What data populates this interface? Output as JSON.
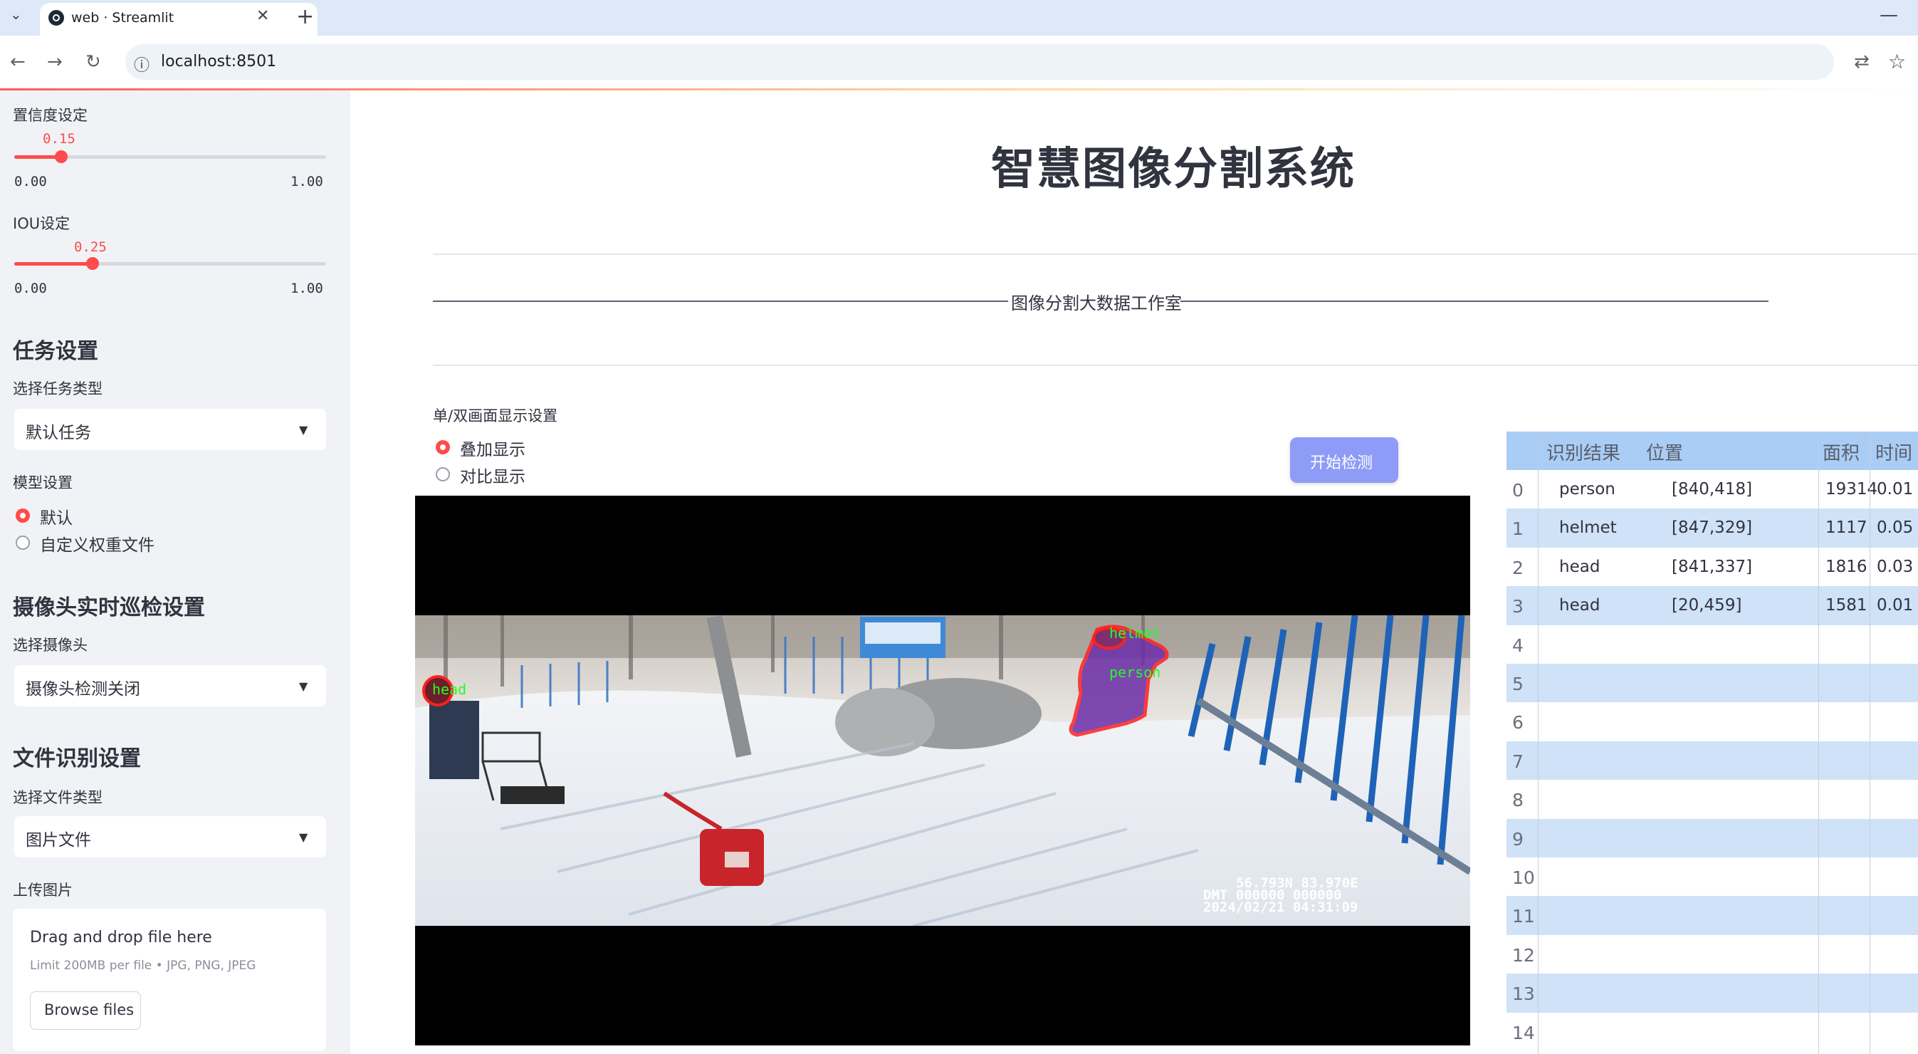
{
  "browser": {
    "tab_title": "web · Streamlit",
    "url": "localhost:8501",
    "icons": {
      "tab_list": "chevron-down-icon",
      "close": "close-icon",
      "new_tab": "plus-icon",
      "back": "arrow-left-icon",
      "forward": "arrow-right-icon",
      "reload": "reload-icon",
      "site_info": "info-icon",
      "translate": "translate-icon",
      "bookmark": "star-icon",
      "minimize": "minimize-icon"
    }
  },
  "sidebar": {
    "confidence": {
      "label": "置信度设定",
      "value": "0.15",
      "min": "0.00",
      "max": "1.00",
      "fraction": 0.15
    },
    "iou": {
      "label": "IOU设定",
      "value": "0.25",
      "min": "0.00",
      "max": "1.00",
      "fraction": 0.25
    },
    "task": {
      "header": "任务设置",
      "label": "选择任务类型",
      "selected": "默认任务"
    },
    "model": {
      "label": "模型设置",
      "options": [
        "默认",
        "自定义权重文件"
      ],
      "selected_index": 0
    },
    "camera": {
      "header": "摄像头实时巡检设置",
      "label": "选择摄像头",
      "selected": "摄像头检测关闭"
    },
    "file": {
      "header": "文件识别设置",
      "label": "选择文件类型",
      "selected": "图片文件"
    },
    "upload": {
      "label": "上传图片",
      "drop_text": "Drag and drop file here",
      "limit_text": "Limit 200MB per file • JPG, PNG, JPEG",
      "browse_label": "Browse files"
    }
  },
  "main": {
    "title": "智慧图像分割系统",
    "divider_text": "图像分割大数据工作室",
    "display_label": "单/双画面显示设置",
    "display_options": [
      "叠加显示",
      "对比显示"
    ],
    "display_selected_index": 0,
    "start_button": "开始检测",
    "image": {
      "labels": {
        "head_left": "head",
        "helmet": "helmet",
        "person": "person"
      },
      "osd": [
        "56.793N  83.970E",
        "DMT 000000 000000",
        "2024/02/21 04:31:09"
      ]
    }
  },
  "results_table": {
    "columns": [
      "识别结果",
      "位置",
      "面积",
      "时间"
    ],
    "rows": [
      {
        "index": "0",
        "label": "person",
        "position": "[840,418]",
        "area": "19314",
        "time": "0.01"
      },
      {
        "index": "1",
        "label": "helmet",
        "position": "[847,329]",
        "area": "1117",
        "time": "0.05"
      },
      {
        "index": "2",
        "label": "head",
        "position": "[841,337]",
        "area": "1816",
        "time": "0.03"
      },
      {
        "index": "3",
        "label": "head",
        "position": "[20,459]",
        "area": "1581",
        "time": "0.01"
      },
      {
        "index": "4",
        "label": "",
        "position": "",
        "area": "",
        "time": ""
      },
      {
        "index": "5",
        "label": "",
        "position": "",
        "area": "",
        "time": ""
      },
      {
        "index": "6",
        "label": "",
        "position": "",
        "area": "",
        "time": ""
      },
      {
        "index": "7",
        "label": "",
        "position": "",
        "area": "",
        "time": ""
      },
      {
        "index": "8",
        "label": "",
        "position": "",
        "area": "",
        "time": ""
      },
      {
        "index": "9",
        "label": "",
        "position": "",
        "area": "",
        "time": ""
      },
      {
        "index": "10",
        "label": "",
        "position": "",
        "area": "",
        "time": ""
      },
      {
        "index": "11",
        "label": "",
        "position": "",
        "area": "",
        "time": ""
      },
      {
        "index": "12",
        "label": "",
        "position": "",
        "area": "",
        "time": ""
      },
      {
        "index": "13",
        "label": "",
        "position": "",
        "area": "",
        "time": ""
      },
      {
        "index": "14",
        "label": "",
        "position": "",
        "area": "",
        "time": ""
      }
    ]
  },
  "colors": {
    "accent": "#ff4b4b",
    "button": "#8e9bf7",
    "table_header": "#a9cdf5",
    "table_band": "#cfe2f7"
  }
}
